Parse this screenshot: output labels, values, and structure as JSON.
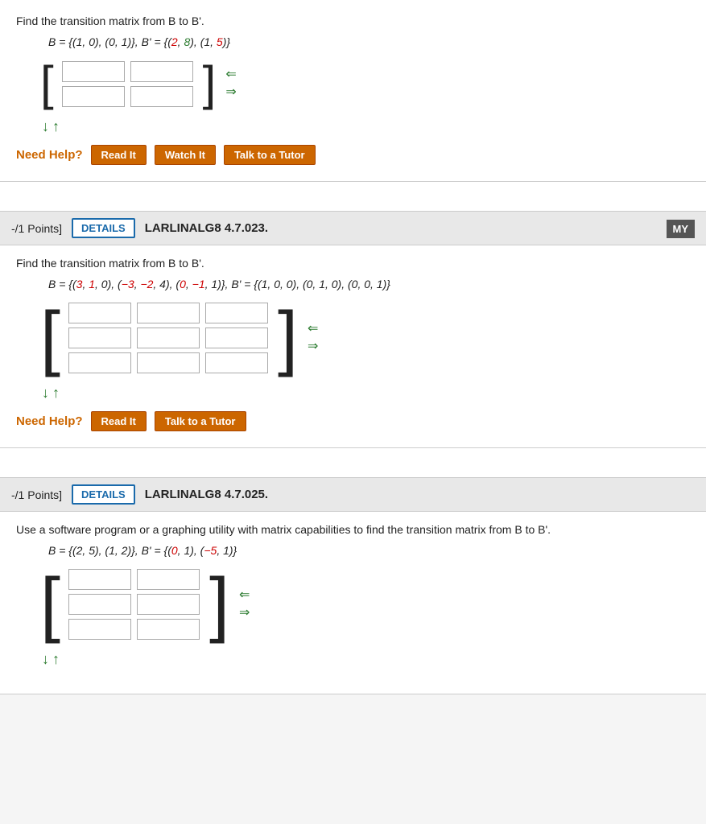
{
  "sections": [
    {
      "id": "section1",
      "is_first": true,
      "problem_text": "Find the transition matrix from B to B'.",
      "math_line_parts": [
        {
          "text": "B",
          "style": "italic"
        },
        {
          "text": " = {(1, 0), (0, 1)}, ",
          "style": "normal"
        },
        {
          "text": "B'",
          "style": "italic"
        },
        {
          "text": " = {(",
          "style": "normal"
        },
        {
          "text": "2",
          "style": "red"
        },
        {
          "text": ", ",
          "style": "normal"
        },
        {
          "text": "8",
          "style": "green"
        },
        {
          "text": "), (1, ",
          "style": "normal"
        },
        {
          "text": "5",
          "style": "red"
        },
        {
          "text": ")}",
          "style": "normal"
        }
      ],
      "matrix_cols": 2,
      "matrix_rows": 2,
      "show_watch": true,
      "help_buttons": [
        "Read It",
        "Watch It",
        "Talk to a Tutor"
      ]
    },
    {
      "id": "section2",
      "points_label": "-/1 Points]",
      "details_label": "DETAILS",
      "title_label": "LARLINALG8 4.7.023.",
      "show_my": true,
      "my_label": "MY",
      "problem_text": "Find the transition matrix from B to B'.",
      "math_line_parts": [
        {
          "text": "B",
          "style": "italic"
        },
        {
          "text": " = {(",
          "style": "normal"
        },
        {
          "text": "3",
          "style": "red"
        },
        {
          "text": ", ",
          "style": "normal"
        },
        {
          "text": "1",
          "style": "red"
        },
        {
          "text": ", 0), (",
          "style": "normal"
        },
        {
          "text": "−3",
          "style": "red"
        },
        {
          "text": ", ",
          "style": "normal"
        },
        {
          "text": "−2",
          "style": "red"
        },
        {
          "text": ", 4), (",
          "style": "normal"
        },
        {
          "text": "0",
          "style": "red"
        },
        {
          "text": ", ",
          "style": "normal"
        },
        {
          "text": "−1",
          "style": "red"
        },
        {
          "text": ", 1)}, ",
          "style": "normal"
        },
        {
          "text": "B'",
          "style": "italic"
        },
        {
          "text": " = {(1, 0, 0), (0, 1, 0), (0, 0, 1)}",
          "style": "normal"
        }
      ],
      "matrix_cols": 3,
      "matrix_rows": 3,
      "help_buttons": [
        "Read It",
        "Talk to a Tutor"
      ]
    },
    {
      "id": "section3",
      "points_label": "-/1 Points]",
      "details_label": "DETAILS",
      "title_label": "LARLINALG8 4.7.025.",
      "problem_text": "Use a software program or a graphing utility with matrix capabilities to find the transition matrix from B to B'.",
      "math_line_parts": [
        {
          "text": "B",
          "style": "italic"
        },
        {
          "text": " = {(2, 5), (1, 2)}, ",
          "style": "normal"
        },
        {
          "text": "B'",
          "style": "italic"
        },
        {
          "text": " = {(",
          "style": "normal"
        },
        {
          "text": "0",
          "style": "red"
        },
        {
          "text": ", 1), (",
          "style": "normal"
        },
        {
          "text": "−5",
          "style": "red"
        },
        {
          "text": ", 1)}",
          "style": "normal"
        }
      ],
      "matrix_cols": 2,
      "matrix_rows": 3,
      "help_buttons": []
    }
  ],
  "need_help_label": "Need Help?",
  "arrow_left": "⇐",
  "arrow_right": "⇒",
  "arrow_down": "↓",
  "arrow_up": "↑"
}
